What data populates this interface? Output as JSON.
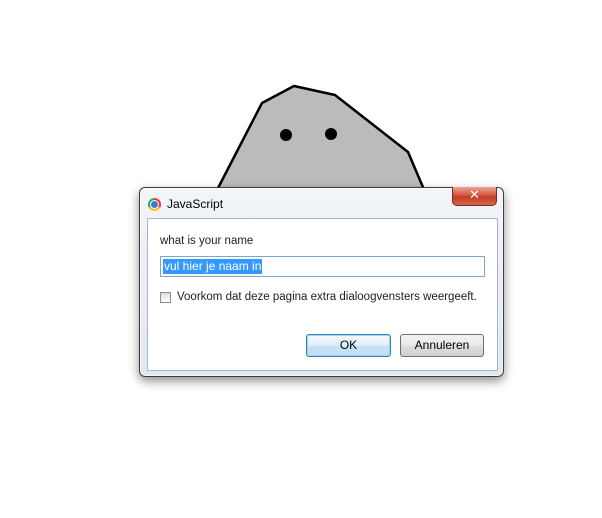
{
  "dialog": {
    "title": "JavaScript",
    "close_label": "✕",
    "prompt": "what is your name",
    "input_value": "vul hier je naam in",
    "checkbox_label": "Voorkom dat deze pagina extra dialoogvensters weergeeft.",
    "checkbox_checked": false,
    "ok_label": "OK",
    "cancel_label": "Annuleren"
  },
  "colors": {
    "rock_fill": "#bbbbbb",
    "selection": "#3399ff",
    "close_button": "#c83c24"
  },
  "icons": [
    "chrome-icon",
    "close-icon",
    "checkbox"
  ]
}
